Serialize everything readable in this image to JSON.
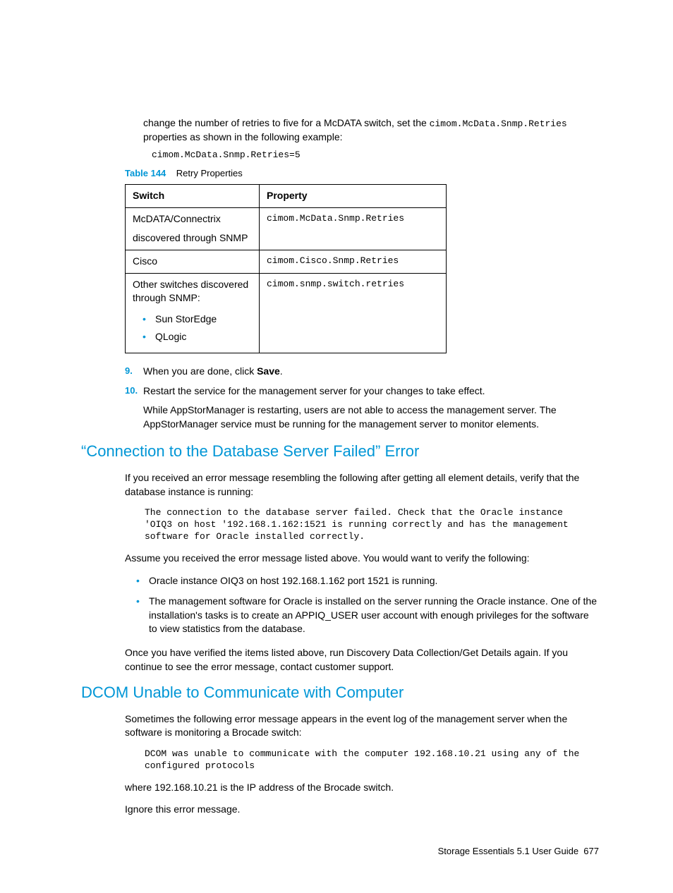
{
  "intro": {
    "line1_a": "change the number of retries to five for a McDATA switch, set the ",
    "line1_code": "cimom.McData.Snmp.Retries",
    "line1_b": " properties as shown in the following example:",
    "example_code": "cimom.McData.Snmp.Retries=5"
  },
  "table": {
    "caption_label": "Table 144",
    "caption_text": "Retry Properties",
    "headers": {
      "c1": "Switch",
      "c2": "Property"
    },
    "rows": [
      {
        "switch_line1": "McDATA/Connectrix",
        "switch_line2": "discovered through SNMP",
        "property": "cimom.McData.Snmp.Retries"
      },
      {
        "switch_line1": "Cisco",
        "property": "cimom.Cisco.Snmp.Retries"
      },
      {
        "switch_line1": "Other switches discovered through SNMP:",
        "bullets": [
          "Sun StorEdge",
          "QLogic"
        ],
        "property": "cimom.snmp.switch.retries"
      }
    ]
  },
  "steps": {
    "s9": {
      "num": "9.",
      "text_a": "When you are done, click ",
      "bold": "Save",
      "text_b": "."
    },
    "s10": {
      "num": "10.",
      "text": "Restart the service for the management server for your changes to take effect.",
      "sub": "While AppStorManager is restarting, users are not able to access the management server. The AppStorManager service must be running for the management server to monitor elements."
    }
  },
  "section1": {
    "heading": "“Connection to the Database Server Failed” Error",
    "p1": "If you received an error message resembling the following after getting all element details, verify that the database instance is running:",
    "msg": "The connection to the database server failed. Check that the Oracle instance 'OIQ3 on host '192.168.1.162:1521 is running correctly and has the management software for Oracle installed correctly.",
    "p2": "Assume you received the error message listed above. You would want to verify the following:",
    "bullets": [
      "Oracle instance OIQ3 on host 192.168.1.162 port 1521 is running.",
      "The management software for Oracle is installed on the server running the Oracle instance. One of the installation's tasks is to create an APPIQ_USER user account with enough privileges for the software to view statistics from the database."
    ],
    "p3": "Once you have verified the items listed above, run Discovery Data Collection/Get Details again. If you continue to see the error message, contact customer support."
  },
  "section2": {
    "heading": "DCOM Unable to Communicate with Computer",
    "p1": "Sometimes the following error message appears in the event log of the management server when the software is monitoring a Brocade switch:",
    "msg": "DCOM was unable to communicate with the computer 192.168.10.21 using any of the configured protocols",
    "p2": "where 192.168.10.21 is the IP address of the Brocade switch.",
    "p3": "Ignore this error message."
  },
  "footer": {
    "title": "Storage Essentials 5.1 User Guide",
    "page": "677"
  }
}
